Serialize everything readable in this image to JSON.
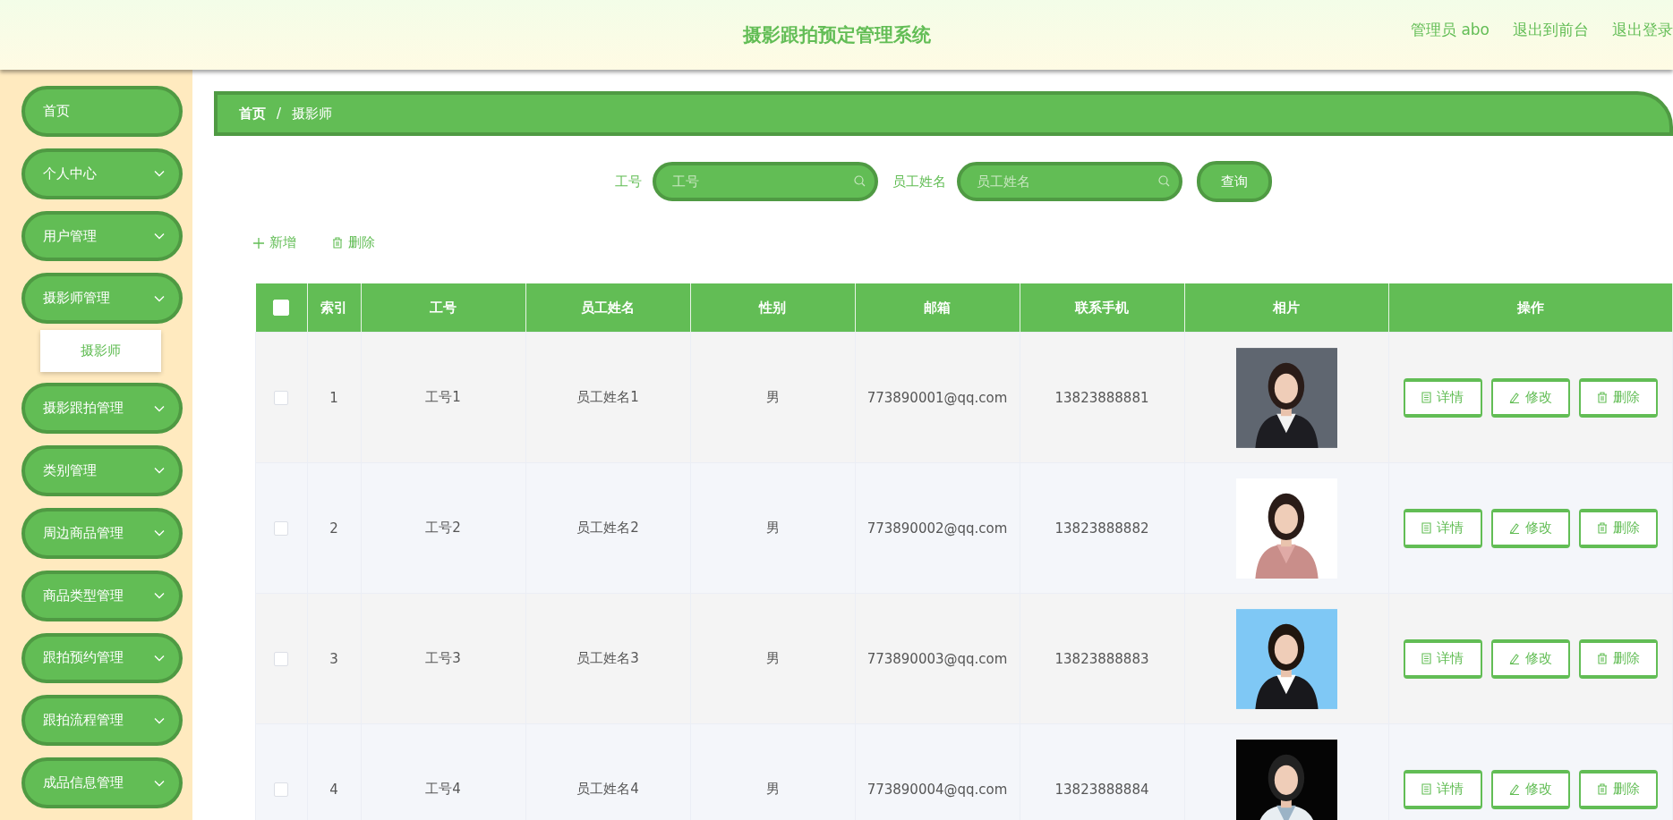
{
  "header": {
    "title": "摄影跟拍预定管理系统",
    "links": [
      "管理员 abo",
      "退出到前台",
      "退出登录"
    ]
  },
  "sidebar": {
    "items": [
      {
        "label": "首页",
        "kind": "link"
      },
      {
        "label": "个人中心",
        "kind": "submenu",
        "expanded": false
      },
      {
        "label": "用户管理",
        "kind": "submenu",
        "expanded": false
      },
      {
        "label": "摄影师管理",
        "kind": "submenu",
        "expanded": true,
        "children": [
          {
            "label": "摄影师"
          }
        ]
      },
      {
        "label": "摄影跟拍管理",
        "kind": "submenu",
        "expanded": false
      },
      {
        "label": "类别管理",
        "kind": "submenu",
        "expanded": false
      },
      {
        "label": "周边商品管理",
        "kind": "submenu",
        "expanded": false
      },
      {
        "label": "商品类型管理",
        "kind": "submenu",
        "expanded": false
      },
      {
        "label": "跟拍预约管理",
        "kind": "submenu",
        "expanded": false
      },
      {
        "label": "跟拍流程管理",
        "kind": "submenu",
        "expanded": false
      },
      {
        "label": "成品信息管理",
        "kind": "submenu",
        "expanded": false
      }
    ]
  },
  "breadcrumb": [
    "首页",
    "/",
    "摄影师"
  ],
  "search": {
    "fields": [
      {
        "label": "工号",
        "placeholder": "工号"
      },
      {
        "label": "员工姓名",
        "placeholder": "员工姓名"
      }
    ],
    "button": "查询"
  },
  "actions": [
    "新增",
    "删除"
  ],
  "table": {
    "select_all": {
      "checked": false
    },
    "columns": [
      "索引",
      "工号",
      "员工姓名",
      "性别",
      "邮箱",
      "联系手机",
      "相片",
      "操作"
    ],
    "rows": [
      {
        "selected": false,
        "cells": [
          "1",
          "工号1",
          "员工姓名1",
          "男",
          "773890001@qq.com",
          "13823888881"
        ],
        "photo": {
          "kind": "picture"
        },
        "buttons": [
          "详情",
          "修改",
          "删除"
        ]
      },
      {
        "selected": false,
        "cells": [
          "2",
          "工号2",
          "员工姓名2",
          "男",
          "773890002@qq.com",
          "13823888882"
        ],
        "photo": {
          "kind": "picture"
        },
        "buttons": [
          "详情",
          "修改",
          "删除"
        ]
      },
      {
        "selected": false,
        "cells": [
          "3",
          "工号3",
          "员工姓名3",
          "男",
          "773890003@qq.com",
          "13823888883"
        ],
        "photo": {
          "kind": "picture"
        },
        "buttons": [
          "详情",
          "修改",
          "删除"
        ]
      },
      {
        "selected": false,
        "cells": [
          "4",
          "工号4",
          "员工姓名4",
          "男",
          "773890004@qq.com",
          "13823888884"
        ],
        "photo": {
          "kind": "picture"
        },
        "buttons": [
          "详情",
          "修改",
          "删除"
        ]
      }
    ]
  }
}
